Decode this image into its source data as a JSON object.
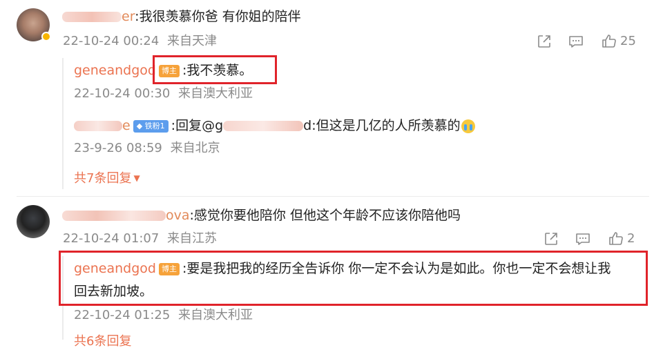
{
  "comments": [
    {
      "name_visible": "er",
      "text": ":我很羡慕你爸 有你姐的陪伴",
      "date": "22-10-24 00:24",
      "location": "来自天津",
      "likes": "25",
      "replies": [
        {
          "name": "geneandgod",
          "badge": "博主",
          "text": ":我不羡慕。",
          "date": "22-10-24 00:30",
          "location": "来自澳大利亚"
        },
        {
          "name_visible": "e",
          "badge": "铁粉1",
          "text_prefix": ":回复@g",
          "text_mid": "d",
          "text": ":但这是几亿的人所羡慕的",
          "emoji": "crying-face",
          "date": "23-9-26 08:59",
          "location": "来自北京"
        }
      ],
      "more_replies": "共7条回复"
    },
    {
      "name_visible": "ova",
      "text": ":感觉你要他陪你 但他这个年龄不应该你陪他吗",
      "date": "22-10-24 01:07",
      "location": "来自江苏",
      "likes": "2",
      "replies": [
        {
          "name": "geneandgod",
          "badge": "博主",
          "text_line1": ":要是我把我的经历全告诉你 你一定不会认为是如此。你也一定不会想让我",
          "text_line2": "回去新加坡。",
          "date": "22-10-24 01:25",
          "location": "来自澳大利亚"
        }
      ],
      "more_replies": "共6条回复"
    }
  ],
  "icons": [
    "share-icon",
    "comment-icon",
    "like-icon",
    "verified-badge-icon",
    "dropdown-arrow-icon",
    "crying-emoji"
  ],
  "colors": {
    "username": "#eb7350",
    "highlight_box": "#e0232a",
    "host_badge": "#f6a23a",
    "fan_badge": "#5c9ded"
  }
}
